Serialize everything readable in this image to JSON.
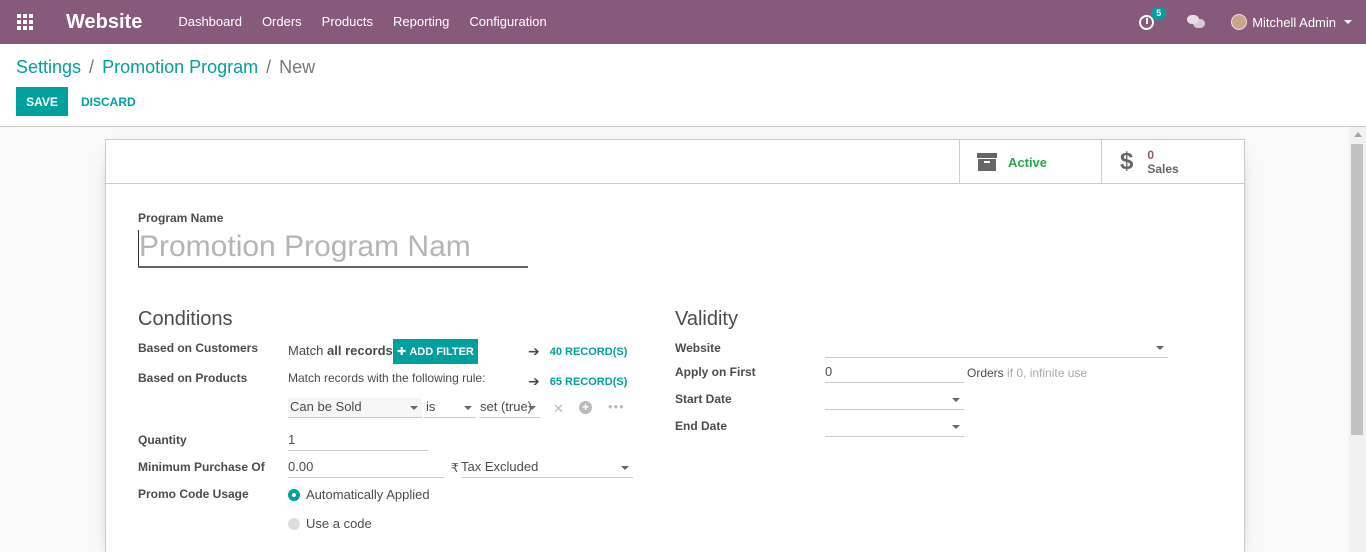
{
  "navbar": {
    "brand": "Website",
    "menu": [
      "Dashboard",
      "Orders",
      "Products",
      "Reporting",
      "Configuration"
    ],
    "activity_count": "5",
    "user_name": "Mitchell Admin"
  },
  "breadcrumb": {
    "settings": "Settings",
    "separator": "/",
    "program": "Promotion Program",
    "current": "New"
  },
  "toolbar": {
    "save_label": "SAVE",
    "discard_label": "DISCARD"
  },
  "smart_buttons": {
    "active_label": "Active",
    "sales_value": "0",
    "sales_label": "Sales"
  },
  "form": {
    "program_name_label": "Program Name",
    "program_name_placeholder": "Promotion Program Nam",
    "conditions_title": "Conditions",
    "based_on_customers_label": "Based on Customers",
    "customers_match_prefix": "Match",
    "customers_match_bold": "all records",
    "add_filter_label": "ADD FILTER",
    "customers_records": "40 RECORD(S)",
    "based_on_products_label": "Based on Products",
    "products_rule_text": "Match records with the following rule:",
    "products_records": "65 RECORD(S)",
    "rule_field": "Can be Sold",
    "rule_operator": "is",
    "rule_value": "set (true)",
    "quantity_label": "Quantity",
    "quantity_value": "1",
    "min_purchase_label": "Minimum Purchase Of",
    "min_purchase_value": "0.00",
    "currency_symbol": "₹",
    "tax_mode": "Tax Excluded",
    "promo_usage_label": "Promo Code Usage",
    "promo_option_auto": "Automatically Applied",
    "promo_option_code": "Use a code",
    "validity_title": "Validity",
    "website_label": "Website",
    "website_value": "",
    "apply_first_label": "Apply on First",
    "apply_first_value": "0",
    "orders_label": "Orders",
    "orders_hint": "if 0, infinite use",
    "start_date_label": "Start Date",
    "start_date_value": "",
    "end_date_label": "End Date",
    "end_date_value": ""
  },
  "colors": {
    "navbar": "#875a7b",
    "accent": "#00a09d",
    "active": "#28a745"
  }
}
